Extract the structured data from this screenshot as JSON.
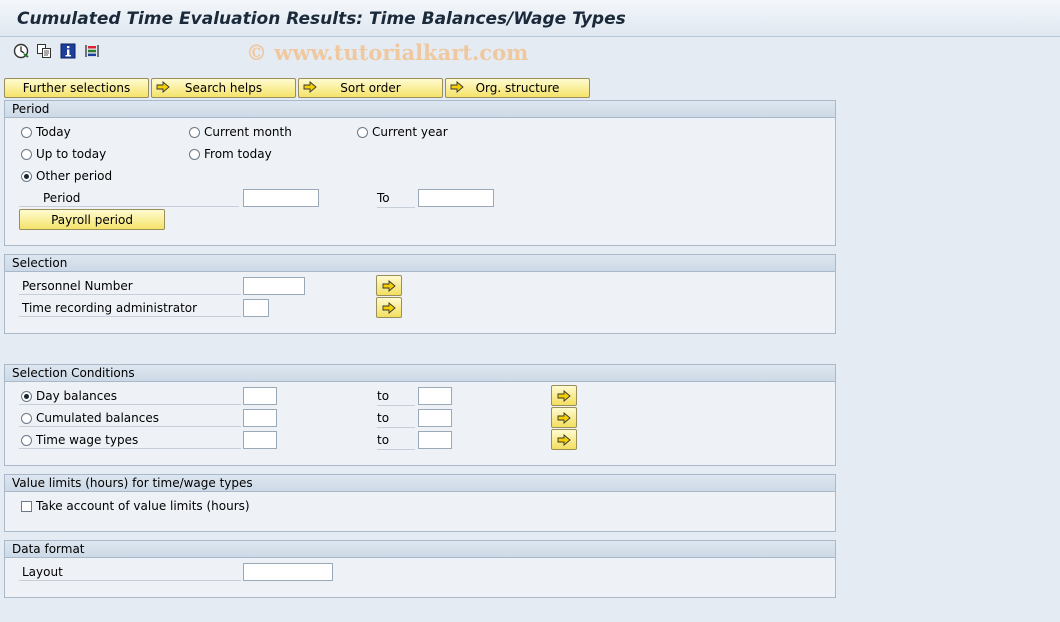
{
  "window": {
    "title": "Cumulated Time Evaluation Results: Time Balances/Wage Types",
    "watermark": "© www.tutorialkart.com"
  },
  "toolbar": {
    "icons": [
      "execute-icon",
      "copy-variant-icon",
      "info-icon",
      "selection-options-icon"
    ]
  },
  "top_buttons": {
    "further_selections": "Further selections",
    "search_helps": "Search helps",
    "sort_order": "Sort order",
    "org_structure": "Org. structure"
  },
  "period": {
    "title": "Period",
    "today": "Today",
    "current_month": "Current month",
    "current_year": "Current year",
    "up_to_today": "Up to today",
    "from_today": "From today",
    "other_period": "Other period",
    "selected": "other_period",
    "period_label": "Period",
    "period_from": "",
    "to_label": "To",
    "period_to": "",
    "payroll_button": "Payroll period"
  },
  "selection": {
    "title": "Selection",
    "personnel_number_label": "Personnel Number",
    "personnel_number_value": "",
    "time_admin_label": "Time recording administrator",
    "time_admin_value": ""
  },
  "selection_conditions": {
    "title": "Selection Conditions",
    "day_balances": "Day balances",
    "cumulated_balances": "Cumulated balances",
    "time_wage_types": "Time wage types",
    "selected": "day_balances",
    "to_label": "to"
  },
  "value_limits": {
    "title": "Value limits (hours) for time/wage types",
    "take_account_label": "Take account of value limits (hours)",
    "checked": false
  },
  "data_format": {
    "title": "Data format",
    "layout_label": "Layout",
    "layout_value": ""
  },
  "colors": {
    "background": "#e4ebf3",
    "button_yellow": "#f5e36a",
    "group_header": "#cdd9e6"
  }
}
